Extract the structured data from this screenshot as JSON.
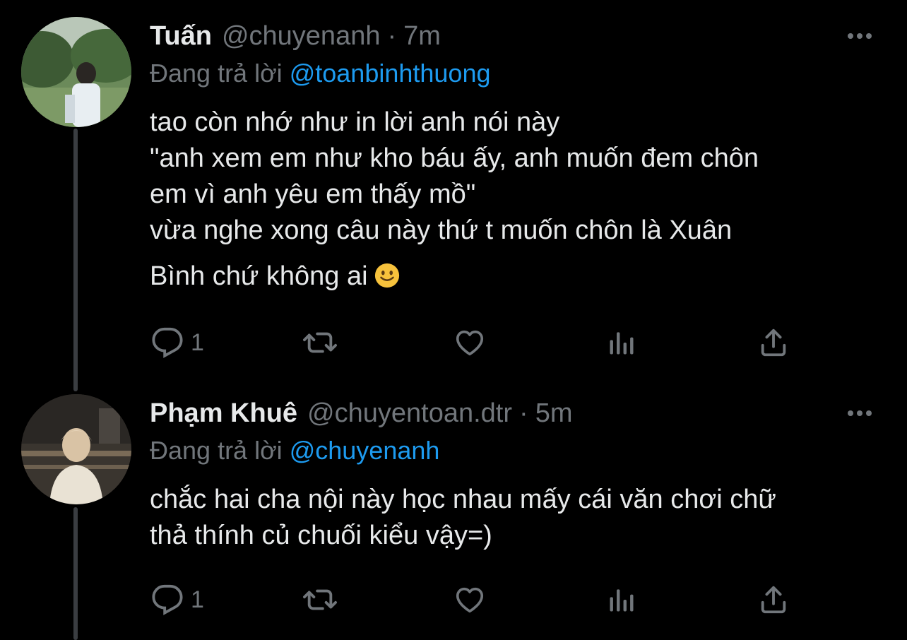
{
  "tweets": [
    {
      "name": "Tuấn",
      "handle": "@chuyenanh",
      "separator": "·",
      "time": "7m",
      "reply_prefix": "Đang trả lời",
      "reply_to": "@toanbinhthuong",
      "lines": [
        "tao còn nhớ như in lời anh nói này",
        "\"anh xem em như kho báu ấy, anh muốn đem chôn",
        "em vì anh yêu em thấy mồ\"",
        "vừa nghe xong câu này thứ t muốn chôn là Xuân",
        "Bình chứ không ai"
      ],
      "trailing_emoji": "slightly-smiling-face",
      "reply_count": "1"
    },
    {
      "name": "Phạm Khuê",
      "handle": "@chuyentoan.dtr",
      "separator": "·",
      "time": "5m",
      "reply_prefix": "Đang trả lời",
      "reply_to": "@chuyenanh",
      "lines": [
        "chắc hai cha nội này học nhau mấy cái văn chơi chữ",
        "thả thính củ chuối kiểu vậy=)"
      ],
      "reply_count": "1"
    }
  ],
  "icons": {
    "reply": "reply-icon",
    "retweet": "retweet-icon",
    "like": "heart-icon",
    "views": "views-icon",
    "share": "share-icon",
    "more": "more-icon"
  },
  "colors": {
    "background": "#000000",
    "text": "#e7e9ea",
    "muted": "#71767b",
    "link": "#1d9bf0",
    "thread_line": "#3a3d41"
  }
}
